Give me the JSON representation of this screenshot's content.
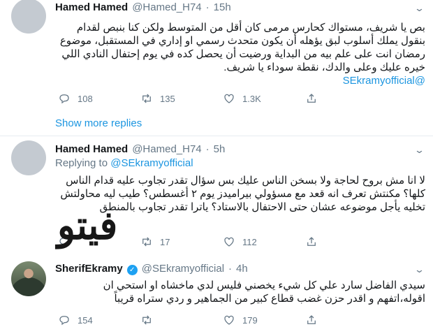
{
  "tweets": [
    {
      "name": "Hamed Hamed",
      "handle": "@Hamed_H74",
      "time": "15h",
      "body": "بص يا شريف، مستواك كحارس مرمى كان أقل من المتوسط ولكن كنا بنبص لقدام بنقول يملك أسلوب لبق يؤهله أن يكون متحدث رسمي او إداري في المستقبل، موضوع رمضان انت على علم بيه من البداية ورضيت أن يحصل كده في يوم إحتفال النادي اللي خيره عليك وعلى والدك، نقطة سوداء يا شريف.",
      "mention": "@SEkramyofficial",
      "replies": "108",
      "retweets": "135",
      "likes": "1.3K"
    },
    {
      "name": "Hamed Hamed",
      "handle": "@Hamed_H74",
      "time": "5h",
      "replying_label": "Replying to",
      "replying_to": "@SEkramyofficial",
      "body": "لا انا مش بروح لحاجة ولا بسخن الناس عليك بس سؤال تقدر تجاوب عليه قدام الناس كلها؟ مكنتش تعرف انه قعد مع مسؤولي بيراميدز يوم ٢ أغسطس؟ طيب ليه محاولتش تخليه يأجل موضوعه عشان حتى الاحتفال بالاستاد؟ ياترا تقدر تجاوب بالمنطق",
      "replies": "",
      "retweets": "17",
      "likes": "112"
    },
    {
      "name": "SherifEkramy",
      "verified": "✓",
      "handle": "@SEkramyofficial",
      "time": "4h",
      "body": "سيدي الفاضل سارد علي كل شيء يخصني فليس لدي ماخشاه او استحي ان اقوله،اتفهم و اقدر حزن غضب قطاع كبير من الجماهير و ردي ستراه قريباً",
      "replies": "154",
      "retweets": "",
      "likes": "179"
    }
  ],
  "dot": "·",
  "show_more": "Show more replies",
  "watermark": {
    "black": "فيتو",
    "red": ""
  },
  "icons": {
    "reply": "reply-icon",
    "retweet": "retweet-icon",
    "like": "heart-icon",
    "share": "share-icon",
    "menu": "chevron-down-icon"
  }
}
